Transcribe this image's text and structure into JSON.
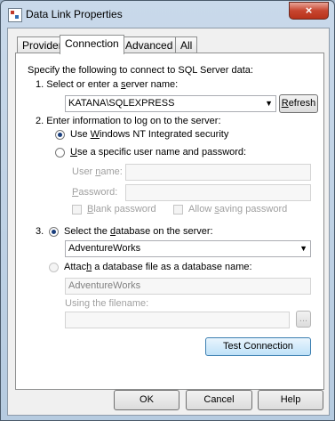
{
  "window": {
    "title": "Data Link Properties",
    "close_glyph": "×"
  },
  "tabs": [
    {
      "label": "Provider"
    },
    {
      "label": "Connection"
    },
    {
      "label": "Advanced"
    },
    {
      "label": "All"
    }
  ],
  "intro": "Specify the following to connect to SQL Server data:",
  "step1": {
    "label": "1. Select or enter a server name:",
    "server_value": "KATANA\\SQLEXPRESS",
    "refresh_label": "Refresh"
  },
  "step2": {
    "label": "2. Enter information to log on to the server:",
    "option_nt": "Use Windows NT Integrated security",
    "option_specific": "Use a specific user name and password:",
    "user_label": "User name:",
    "password_label": "Password:",
    "blank_password": "Blank password",
    "allow_saving": "Allow saving password"
  },
  "step3": {
    "number": "3.",
    "option_select_db": "Select the database on the server:",
    "database_value": "AdventureWorks",
    "option_attach": "Attach a database file as a database name:",
    "attach_value": "AdventureWorks",
    "filename_label": "Using the filename:",
    "browse_label": "..."
  },
  "test_connection": "Test Connection",
  "footer": {
    "ok": "OK",
    "cancel": "Cancel",
    "help": "Help"
  }
}
